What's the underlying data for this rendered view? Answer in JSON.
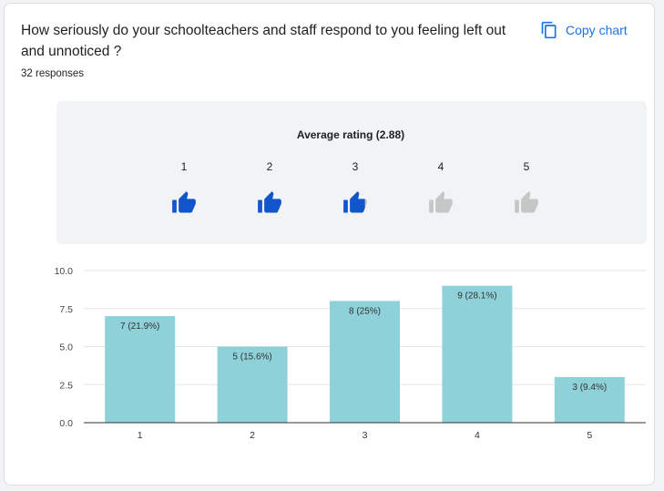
{
  "question": "How seriously do your schoolteachers and staff respond to you feeling left out and unnoticed ?",
  "responses": "32 responses",
  "copy_chart_label": "Copy chart",
  "icons": {
    "copy": "copy-icon",
    "thumb": "thumbs-up-icon"
  },
  "colors": {
    "accent": "#1a73e8",
    "thumb_filled": "#1155cc",
    "thumb_empty": "#c4c7c5",
    "bar": "#8ed1d8"
  },
  "rating": {
    "title": "Average rating (2.88)",
    "average": 2.88,
    "scale": [
      "1",
      "2",
      "3",
      "4",
      "5"
    ]
  },
  "chart_data": {
    "type": "bar",
    "categories": [
      "1",
      "2",
      "3",
      "4",
      "5"
    ],
    "values": [
      7,
      5,
      8,
      9,
      3
    ],
    "labels": [
      "7 (21.9%)",
      "5 (15.6%)",
      "8 (25%)",
      "9 (28.1%)",
      "3 (9.4%)"
    ],
    "ylim": [
      0,
      10
    ],
    "yticks": [
      "0.0",
      "2.5",
      "5.0",
      "7.5",
      "10.0"
    ],
    "grid": true
  }
}
